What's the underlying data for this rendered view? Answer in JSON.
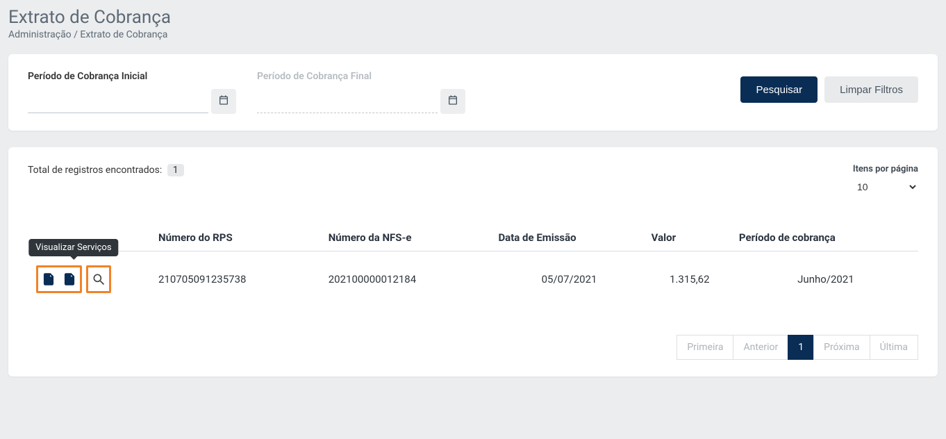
{
  "header": {
    "title": "Extrato de Cobrança",
    "breadcrumb": "Administração / Extrato de Cobrança"
  },
  "filters": {
    "inicial_label": "Período de Cobrança Inicial",
    "final_label": "Período de Cobrança Final",
    "search_btn": "Pesquisar",
    "clear_btn": "Limpar Filtros"
  },
  "results": {
    "total_label": "Total de registros encontrados:",
    "total_count": "1",
    "per_page_label": "Itens por página",
    "per_page_value": "10",
    "tooltip": "Visualizar Serviços",
    "columns": {
      "rps": "Número do RPS",
      "nfse": "Número da NFS-e",
      "data": "Data de Emissão",
      "valor": "Valor",
      "periodo": "Período de cobrança"
    },
    "rows": [
      {
        "rps": "210705091235738",
        "nfse": "202100000012184",
        "data": "05/07/2021",
        "valor": "1.315,62",
        "periodo": "Junho/2021"
      }
    ]
  },
  "pagination": {
    "first": "Primeira",
    "prev": "Anterior",
    "current": "1",
    "next": "Próxima",
    "last": "Última"
  }
}
